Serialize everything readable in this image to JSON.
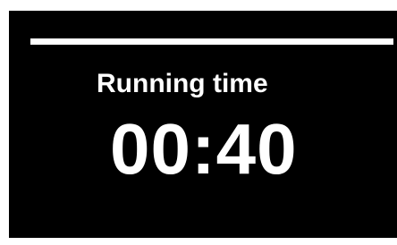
{
  "timer": {
    "label": "Running time",
    "value": "00:40"
  },
  "progress": {
    "fraction": 1.0
  },
  "colors": {
    "background": "#000000",
    "foreground": "#ffffff"
  }
}
